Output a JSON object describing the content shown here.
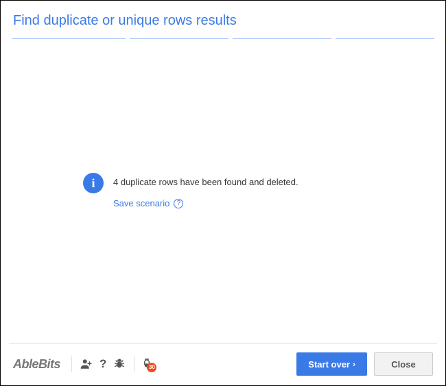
{
  "header": {
    "title": "Find duplicate or unique rows results"
  },
  "main": {
    "info_letter": "i",
    "result_message": "4 duplicate rows have been found and deleted.",
    "save_scenario_label": "Save scenario",
    "help_glyph": "?"
  },
  "footer": {
    "brand": "AbleBits",
    "badge_count": "30",
    "start_over_label": "Start over",
    "close_label": "Close"
  }
}
